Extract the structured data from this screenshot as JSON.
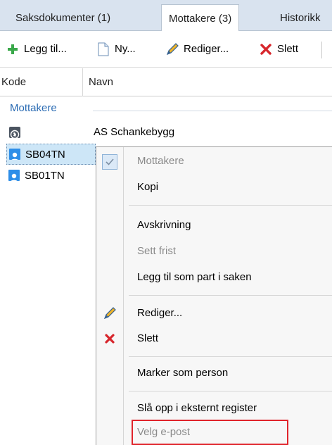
{
  "tabs": [
    {
      "label": "Saksdokumenter (1)",
      "active": false
    },
    {
      "label": "Mottakere (3)",
      "active": true
    },
    {
      "label": "Historikk",
      "active": false
    }
  ],
  "toolbar": {
    "add_label": "Legg til...",
    "new_label": "Ny...",
    "edit_label": "Rediger...",
    "delete_label": "Slett"
  },
  "columns": {
    "code": "Kode",
    "name": "Navn"
  },
  "group": {
    "label": "Mottakere"
  },
  "rows": [
    {
      "code": "",
      "name": "AS Schankebygg",
      "icon": "globe-icon"
    },
    {
      "code": "SB04TN",
      "name": "",
      "icon": "person-icon",
      "selected": true
    },
    {
      "code": "SB01TN",
      "name": "",
      "icon": "person-icon",
      "selected": false
    }
  ],
  "context_menu": {
    "items": [
      {
        "label": "Mottakere",
        "disabled": true,
        "checked": true
      },
      {
        "label": "Kopi",
        "disabled": false
      },
      {
        "label": "Avskrivning",
        "disabled": false
      },
      {
        "label": "Sett frist",
        "disabled": true
      },
      {
        "label": "Legg til som part i saken",
        "disabled": false
      },
      {
        "label": "Rediger...",
        "disabled": false,
        "icon": "pencil-icon"
      },
      {
        "label": "Slett",
        "disabled": false,
        "icon": "delete-x-icon"
      },
      {
        "label": "Marker som person",
        "disabled": false
      },
      {
        "label": "Slå opp i eksternt register",
        "disabled": false
      },
      {
        "label": "Velg e-post",
        "disabled": true,
        "highlighted": true
      }
    ]
  },
  "colors": {
    "tab_bg": "#d9e3ef",
    "selection": "#cde6f7",
    "group_text": "#2a6bb3",
    "highlight_border": "#e0242b"
  }
}
